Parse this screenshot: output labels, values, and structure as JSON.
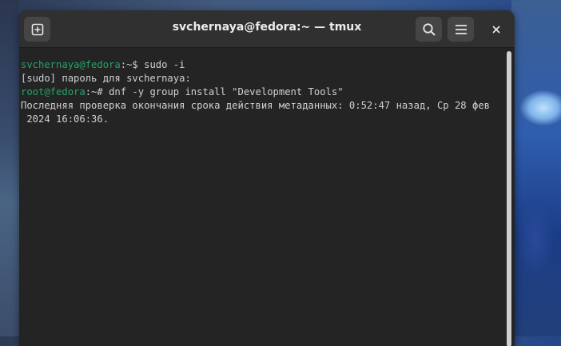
{
  "window": {
    "title": "svchernaya@fedora:~ — tmux"
  },
  "headerbar": {
    "new_tab_icon": "new-tab-icon",
    "search_icon": "search-icon",
    "menu_icon": "hamburger-menu-icon",
    "close_icon": "close-icon"
  },
  "terminal": {
    "line1": {
      "user": "svchernaya@fedora",
      "sep": ":~$ ",
      "cmd": "sudo -i"
    },
    "line2": "[sudo] пароль для svchernaya:",
    "line3": {
      "user": "root@fedora",
      "sep": ":~# ",
      "cmd": "dnf -y group install \"Development Tools\""
    },
    "line4": "Последняя проверка окончания срока действия метаданных: 0:52:47 назад, Ср 28 фев",
    "line5": " 2024 16:06:36."
  },
  "colors": {
    "prompt_user": "#26a269",
    "terminal_bg": "#242424",
    "terminal_fg": "#d0d0d0",
    "headerbar_bg": "#303030"
  }
}
